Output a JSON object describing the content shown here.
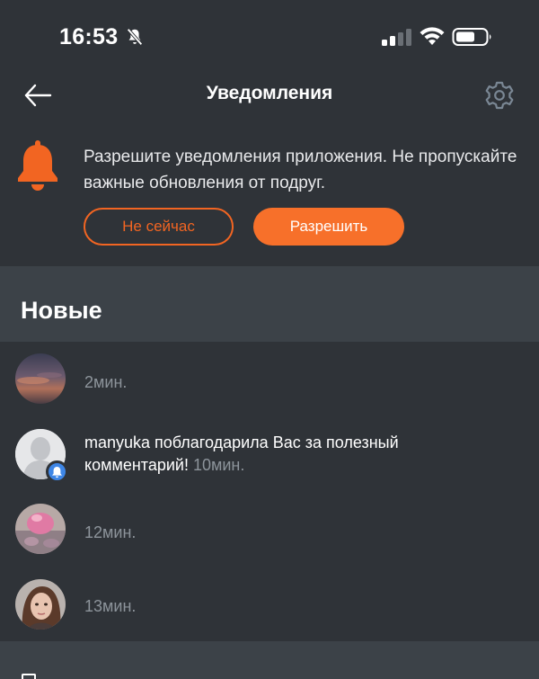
{
  "status_bar": {
    "time": "16:53",
    "icons": [
      "bell-slash-icon",
      "cellular-signal-icon",
      "wifi-icon",
      "battery-icon"
    ]
  },
  "navbar": {
    "title": "Уведомления",
    "back_icon": "arrow-left-icon",
    "settings_icon": "gear-icon"
  },
  "banner": {
    "icon": "bell-icon",
    "text": "Разрешите уведомления приложения. Не пропускайте важные обновления от подруг.",
    "later_label": "Не сейчас",
    "allow_label": "Разрешить"
  },
  "section": {
    "title": "Новые"
  },
  "notifications": [
    {
      "avatar": "sunset-sky-photo",
      "message": "",
      "time": "2мин."
    },
    {
      "avatar": "default-user-avatar",
      "badge_icon": "bell-icon",
      "message": "manyuka поблагодарила Вас за полезный комментарий!",
      "time": "10мин."
    },
    {
      "avatar": "pink-object-photo",
      "message": "",
      "time": "12мин."
    },
    {
      "avatar": "woman-portrait-photo",
      "message": "",
      "time": "13мин."
    }
  ],
  "colors": {
    "background": "#2f3338",
    "section_background": "#3c4248",
    "accent": "#f7702a",
    "muted_text": "#8d949b",
    "badge": "#3e86e6"
  }
}
